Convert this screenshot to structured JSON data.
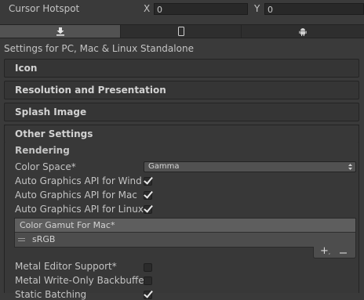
{
  "cursor_hotspot": {
    "label": "Cursor Hotspot",
    "x_label": "X",
    "x_value": "0",
    "y_label": "Y",
    "y_value": "0"
  },
  "tabs": [
    {
      "name": "standalone",
      "icon": "download-icon",
      "selected": true
    },
    {
      "name": "ios",
      "icon": "phone-icon",
      "selected": false
    },
    {
      "name": "android",
      "icon": "android-icon",
      "selected": false
    }
  ],
  "settings_title": "Settings for PC, Mac & Linux Standalone",
  "sections": {
    "icon": "Icon",
    "resolution": "Resolution and Presentation",
    "splash": "Splash Image",
    "other": "Other Settings"
  },
  "rendering": {
    "heading": "Rendering",
    "color_space_label": "Color Space*",
    "color_space_value": "Gamma",
    "auto_api_windows": "Auto Graphics API  for Windows",
    "auto_api_mac": "Auto Graphics API  for Mac",
    "auto_api_linux": "Auto Graphics API  for Linux",
    "gamut_header": "Color Gamut For Mac*",
    "gamut_items": [
      "sRGB"
    ],
    "metal_editor_support": "Metal Editor Support*",
    "metal_write_only": "Metal Write-Only Backbuffer",
    "static_batching": "Static Batching"
  },
  "checkbox_states": {
    "windows": true,
    "mac": true,
    "linux": true,
    "metal_editor": false,
    "metal_write": false,
    "static_batching": true
  },
  "colors": {
    "background": "#3a3a3a",
    "selected_tab": "#525252",
    "list_header": "#5e5e5e",
    "list_item": "#4d4d4d"
  }
}
